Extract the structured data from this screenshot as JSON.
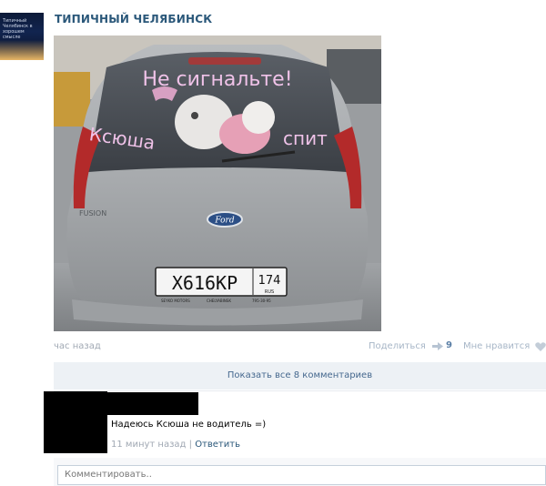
{
  "post": {
    "group_name": "ТИПИЧНЫЙ ЧЕЛЯБИНСК",
    "avatar_text": "Типичный Челябинск в хорошем смысле",
    "time": "час назад",
    "share_label": "Поделиться",
    "share_count": "9",
    "dislike_label": "Мне нравится"
  },
  "photo": {
    "window_text_top": "Не сигнальте!",
    "window_text_left": "Ксюша",
    "window_text_right": "спит",
    "badge": "FUSION",
    "plate_number": "Х616КР",
    "plate_region": "174",
    "plate_country": "RUS",
    "plate_dealer": "SEYKO MOTORS",
    "plate_city": "CHELYABINSK",
    "plate_phone": "795-30-95",
    "brand_logo": "Ford"
  },
  "comments": {
    "show_all_label": "Показать все 8 комментариев",
    "items": [
      {
        "text": "Надеюсь Ксюша не водитель =)",
        "time": "11 минут назад",
        "reply_label": "Ответить"
      }
    ],
    "input_placeholder": "Комментировать.."
  },
  "colors": {
    "link": "#2b587a",
    "meta": "#a0a8b3",
    "show_all_bg": "#edf1f5",
    "window_text": "#efc2e8"
  }
}
